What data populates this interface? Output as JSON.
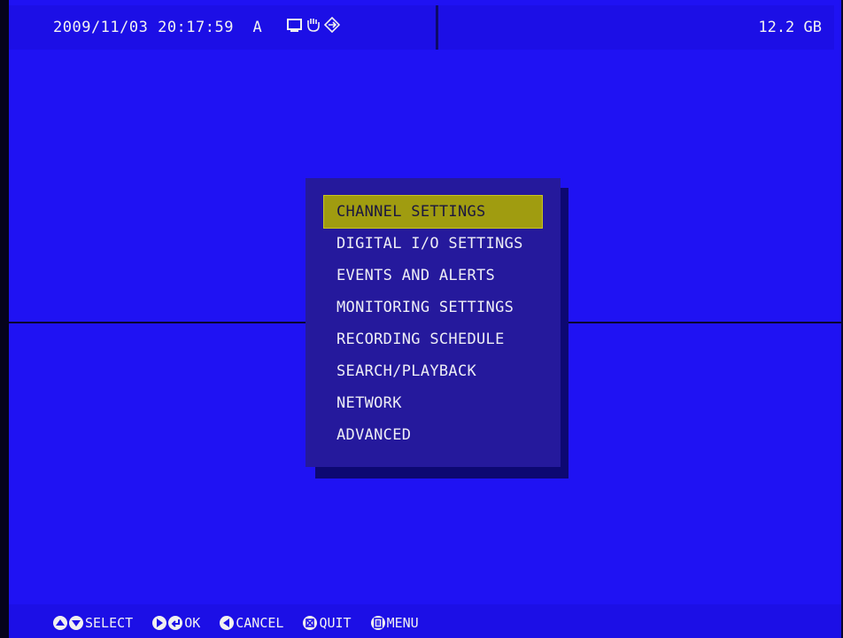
{
  "status_bar": {
    "datetime": "2009/11/03 20:17:59",
    "mode": "A",
    "icons": [
      "monitor-icon",
      "hand-icon",
      "network-icon"
    ],
    "disk_free": "12.2 GB"
  },
  "menu": {
    "selected_index": 0,
    "items": [
      {
        "label": "CHANNEL SETTINGS"
      },
      {
        "label": "DIGITAL I/O SETTINGS"
      },
      {
        "label": "EVENTS AND ALERTS"
      },
      {
        "label": "MONITORING SETTINGS"
      },
      {
        "label": "RECORDING SCHEDULE"
      },
      {
        "label": "SEARCH/PLAYBACK"
      },
      {
        "label": "NETWORK"
      },
      {
        "label": "ADVANCED"
      }
    ]
  },
  "help_bar": {
    "select_label": "SELECT",
    "ok_label": "OK",
    "cancel_label": "CANCEL",
    "quit_label": "QUIT",
    "menu_label": "MENU"
  },
  "colors": {
    "background": "#1f12f3",
    "menu_panel": "#25199c",
    "selected_highlight": "#a09c10"
  }
}
